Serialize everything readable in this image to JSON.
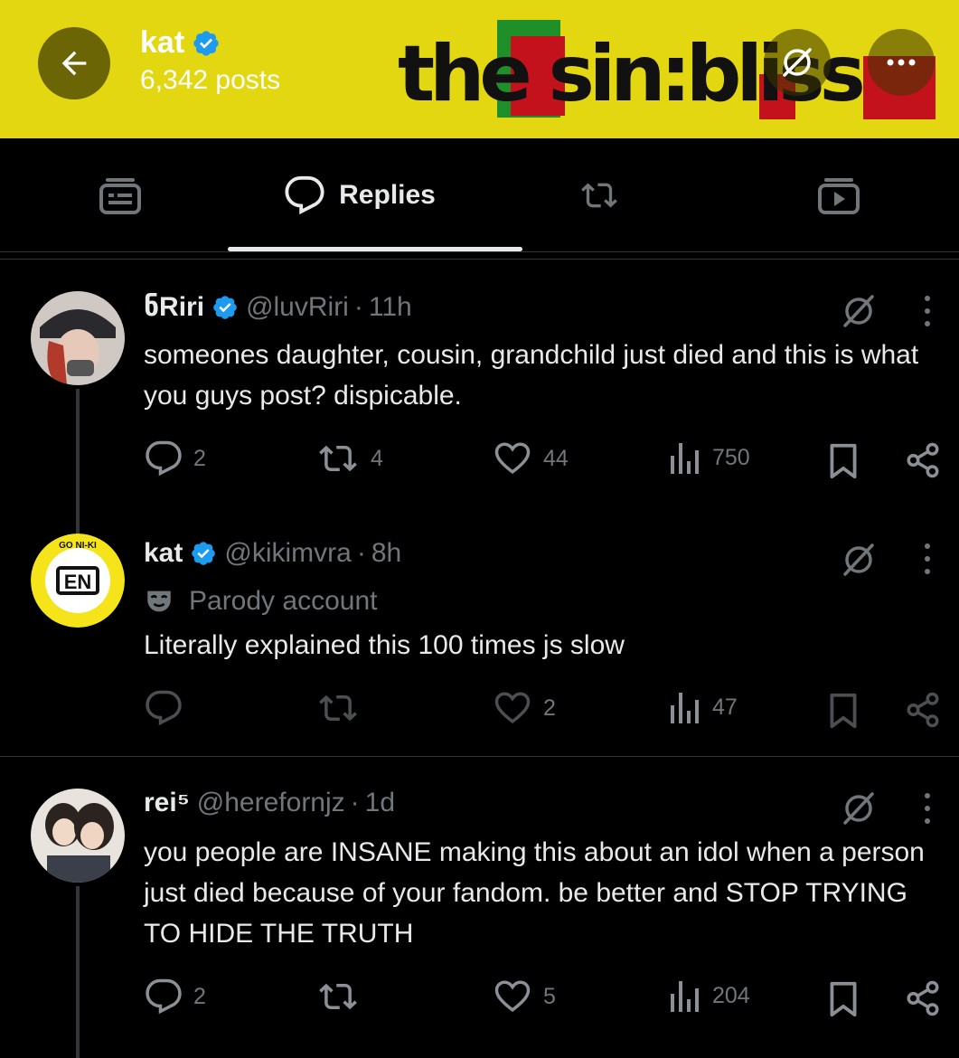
{
  "header": {
    "name": "kat",
    "posts_count": "6,342 posts",
    "banner_text": "the sin:bliss",
    "colors": {
      "banner_bg": "#e3d711",
      "verified": "#1d9bf0"
    }
  },
  "tabs": [
    {
      "label": "",
      "icon": "highlights-icon"
    },
    {
      "label": "Replies",
      "icon": "reply-bubble-icon"
    },
    {
      "label": "",
      "icon": "repost-icon"
    },
    {
      "label": "",
      "icon": "media-icon"
    }
  ],
  "posts": [
    {
      "name": "ნRiri",
      "handle": "@luvRiri",
      "time": "11h",
      "parody_label": "",
      "text": "someones daughter, cousin, grandchild just died and this is what you guys post? dispicable.",
      "replies": "2",
      "reposts": "4",
      "likes": "44",
      "views": "750"
    },
    {
      "name": "kat",
      "handle": "@kikimvra",
      "time": "8h",
      "parody_label": "Parody account",
      "avatar_text": "EN",
      "avatar_ring_text": "GO NI-KI",
      "text": "Literally explained this 100 times js slow",
      "replies": "",
      "reposts": "",
      "likes": "2",
      "views": "47"
    },
    {
      "name": "rei⁵",
      "handle": "@herefornjz",
      "time": "1d",
      "parody_label": "",
      "text": "you people are INSANE making this about an idol when a person just died because of your fandom. be better and STOP TRYING TO HIDE THE TRUTH",
      "replies": "2",
      "reposts": "",
      "likes": "5",
      "views": "204"
    }
  ]
}
